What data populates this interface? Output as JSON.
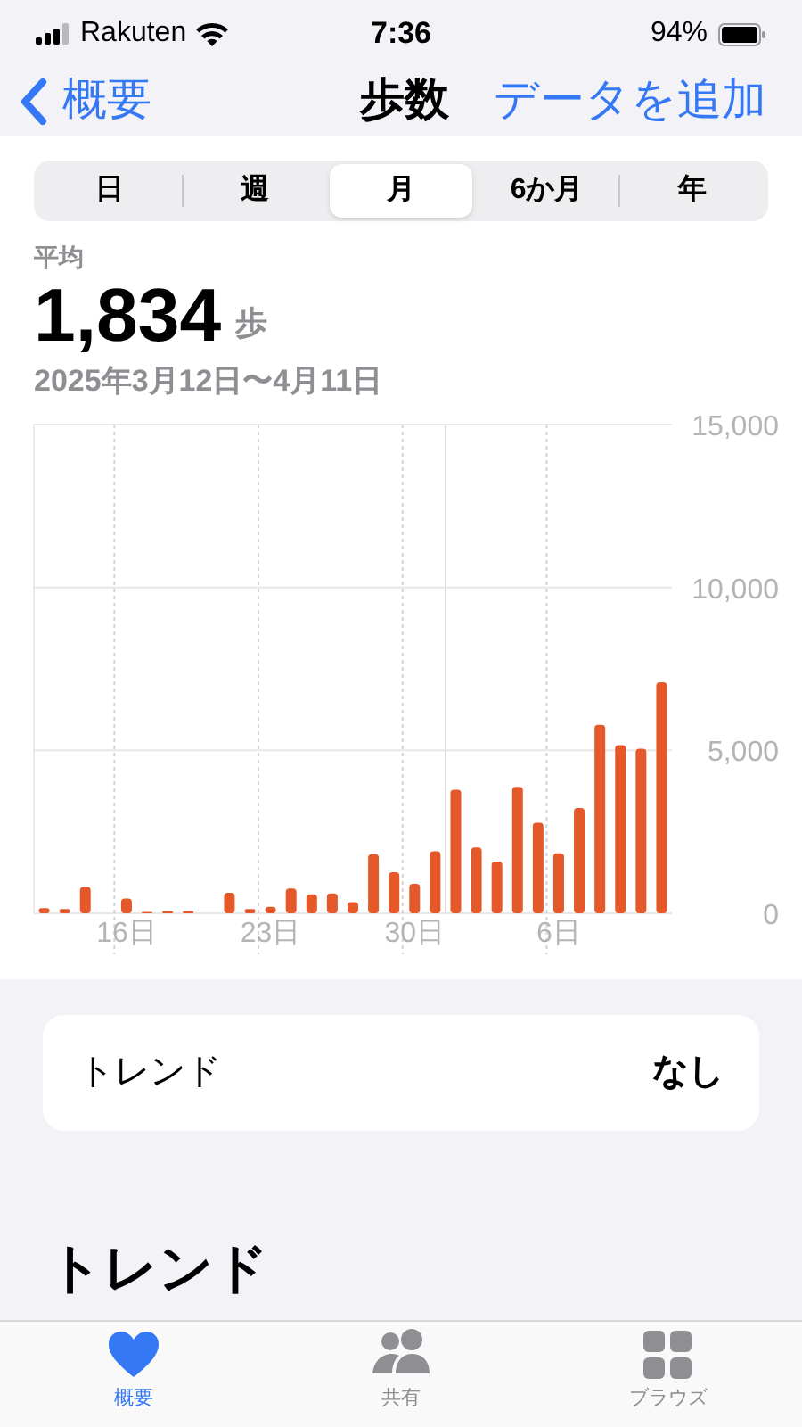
{
  "status_bar": {
    "carrier": "Rakuten",
    "time": "7:36",
    "battery": "94%"
  },
  "nav": {
    "back": "概要",
    "title": "歩数",
    "action": "データを追加"
  },
  "segments": [
    {
      "label": "日",
      "selected": false
    },
    {
      "label": "週",
      "selected": false
    },
    {
      "label": "月",
      "selected": true
    },
    {
      "label": "6か月",
      "selected": false
    },
    {
      "label": "年",
      "selected": false
    }
  ],
  "summary": {
    "label": "平均",
    "value": "1,834",
    "unit": "歩",
    "range": "2025年3月12日〜4月11日"
  },
  "chart": {
    "chart_data": {
      "type": "bar",
      "categories": [
        null,
        null,
        null,
        null,
        "16日",
        null,
        null,
        null,
        null,
        null,
        null,
        "23日",
        null,
        null,
        null,
        null,
        null,
        null,
        "30日",
        null,
        null,
        null,
        null,
        null,
        null,
        "6日",
        null,
        null,
        null,
        null,
        null
      ],
      "series": [
        {
          "color": "#e5582a",
          "values": [
            160,
            130,
            810,
            null,
            450,
            40,
            70,
            70,
            null,
            630,
            130,
            200,
            760,
            580,
            610,
            340,
            1810,
            1260,
            900,
            1900,
            3790,
            2020,
            1590,
            3880,
            2780,
            1840,
            3230,
            5780,
            5160,
            5050,
            7090
          ]
        }
      ],
      "ylim": [
        0,
        15000
      ],
      "grid": true,
      "yticks": [
        {
          "value": 0,
          "label": "0"
        },
        {
          "value": 5000,
          "label": "5,000"
        },
        {
          "value": 10000,
          "label": "10,000"
        },
        {
          "value": 15000,
          "label": "15,000"
        }
      ]
    }
  },
  "trend_row": {
    "label": "トレンド",
    "value": "なし"
  },
  "section_title": "トレンド",
  "tab_bar": [
    {
      "kind": "heart",
      "label": "概要",
      "selected": true
    },
    {
      "kind": "people",
      "label": "共有",
      "selected": false
    },
    {
      "kind": "grid",
      "label": "ブラウズ",
      "selected": false
    }
  ]
}
